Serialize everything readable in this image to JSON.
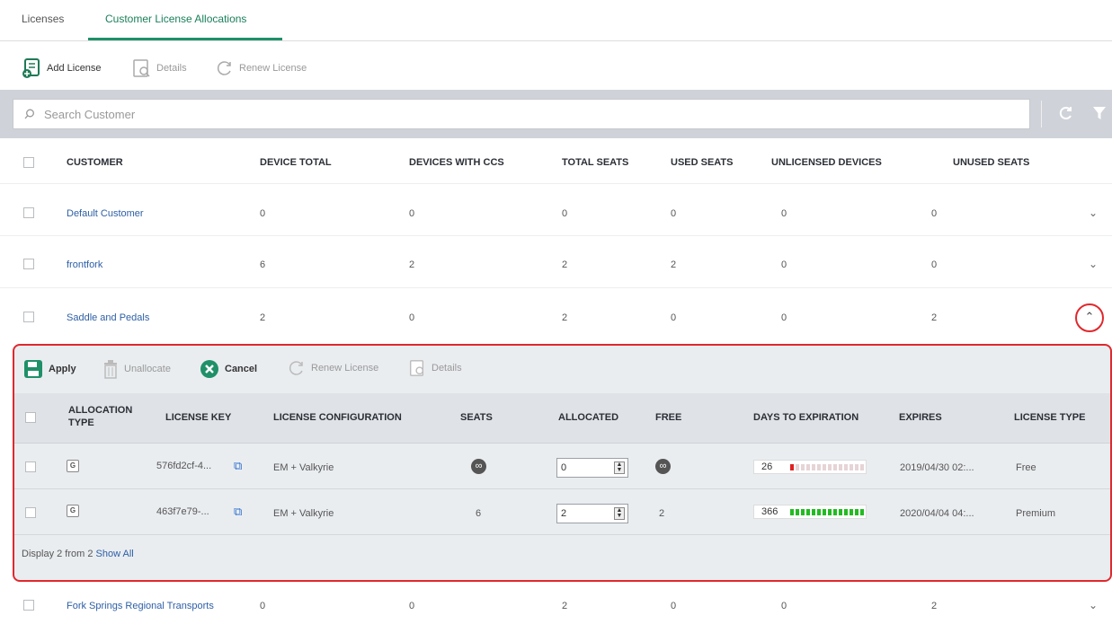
{
  "tabs": [
    {
      "label": "Licenses"
    },
    {
      "label": "Customer License Allocations"
    }
  ],
  "toolbar": {
    "add_license": "Add License",
    "details": "Details",
    "renew_license": "Renew License"
  },
  "search": {
    "placeholder": "Search Customer"
  },
  "table": {
    "headers": [
      "CUSTOMER",
      "DEVICE TOTAL",
      "DEVICES WITH CCS",
      "TOTAL SEATS",
      "USED SEATS",
      "UNLICENSED DEVICES",
      "UNUSED SEATS"
    ],
    "rows": [
      {
        "customer": "Default Customer",
        "device_total": "0",
        "devices_ccs": "0",
        "total_seats": "0",
        "used_seats": "0",
        "unlicensed": "0",
        "unused": "0"
      },
      {
        "customer": "frontfork",
        "device_total": "6",
        "devices_ccs": "2",
        "total_seats": "2",
        "used_seats": "2",
        "unlicensed": "0",
        "unused": "0"
      },
      {
        "customer": "Saddle and Pedals",
        "device_total": "2",
        "devices_ccs": "0",
        "total_seats": "2",
        "used_seats": "0",
        "unlicensed": "0",
        "unused": "2"
      },
      {
        "customer": "Fork Springs Regional Transports",
        "device_total": "0",
        "devices_ccs": "0",
        "total_seats": "2",
        "used_seats": "0",
        "unlicensed": "0",
        "unused": "2"
      }
    ]
  },
  "sub_toolbar": {
    "apply": "Apply",
    "unallocate": "Unallocate",
    "cancel": "Cancel",
    "renew_license": "Renew License",
    "details": "Details"
  },
  "sub_table": {
    "headers": {
      "allocation_type_1": "ALLOCATION",
      "allocation_type_2": "TYPE",
      "license_key": "LICENSE KEY",
      "license_config": "LICENSE CONFIGURATION",
      "seats": "SEATS",
      "allocated": "ALLOCATED",
      "free": "FREE",
      "days_to_expiration": "DAYS TO EXPIRATION",
      "expires": "EXPIRES",
      "license_type": "LICENSE TYPE"
    },
    "rows": [
      {
        "alloc_type": "G",
        "license_key": "576fd2cf-4...",
        "config": "EM + Valkyrie",
        "seats": "∞",
        "allocated": "0",
        "free": "∞",
        "days": "26",
        "days_fraction": 0.07,
        "days_color": "#e02020",
        "expires": "2019/04/30 02:...",
        "license_type": "Free"
      },
      {
        "alloc_type": "G",
        "license_key": "463f7e79-...",
        "config": "EM + Valkyrie",
        "seats": "6",
        "allocated": "2",
        "free": "2",
        "days": "366",
        "days_fraction": 1.0,
        "days_color": "#22bb22",
        "expires": "2020/04/04 04:...",
        "license_type": "Premium"
      }
    ],
    "footer_text": "Display 2 from 2",
    "show_all": "Show All"
  }
}
